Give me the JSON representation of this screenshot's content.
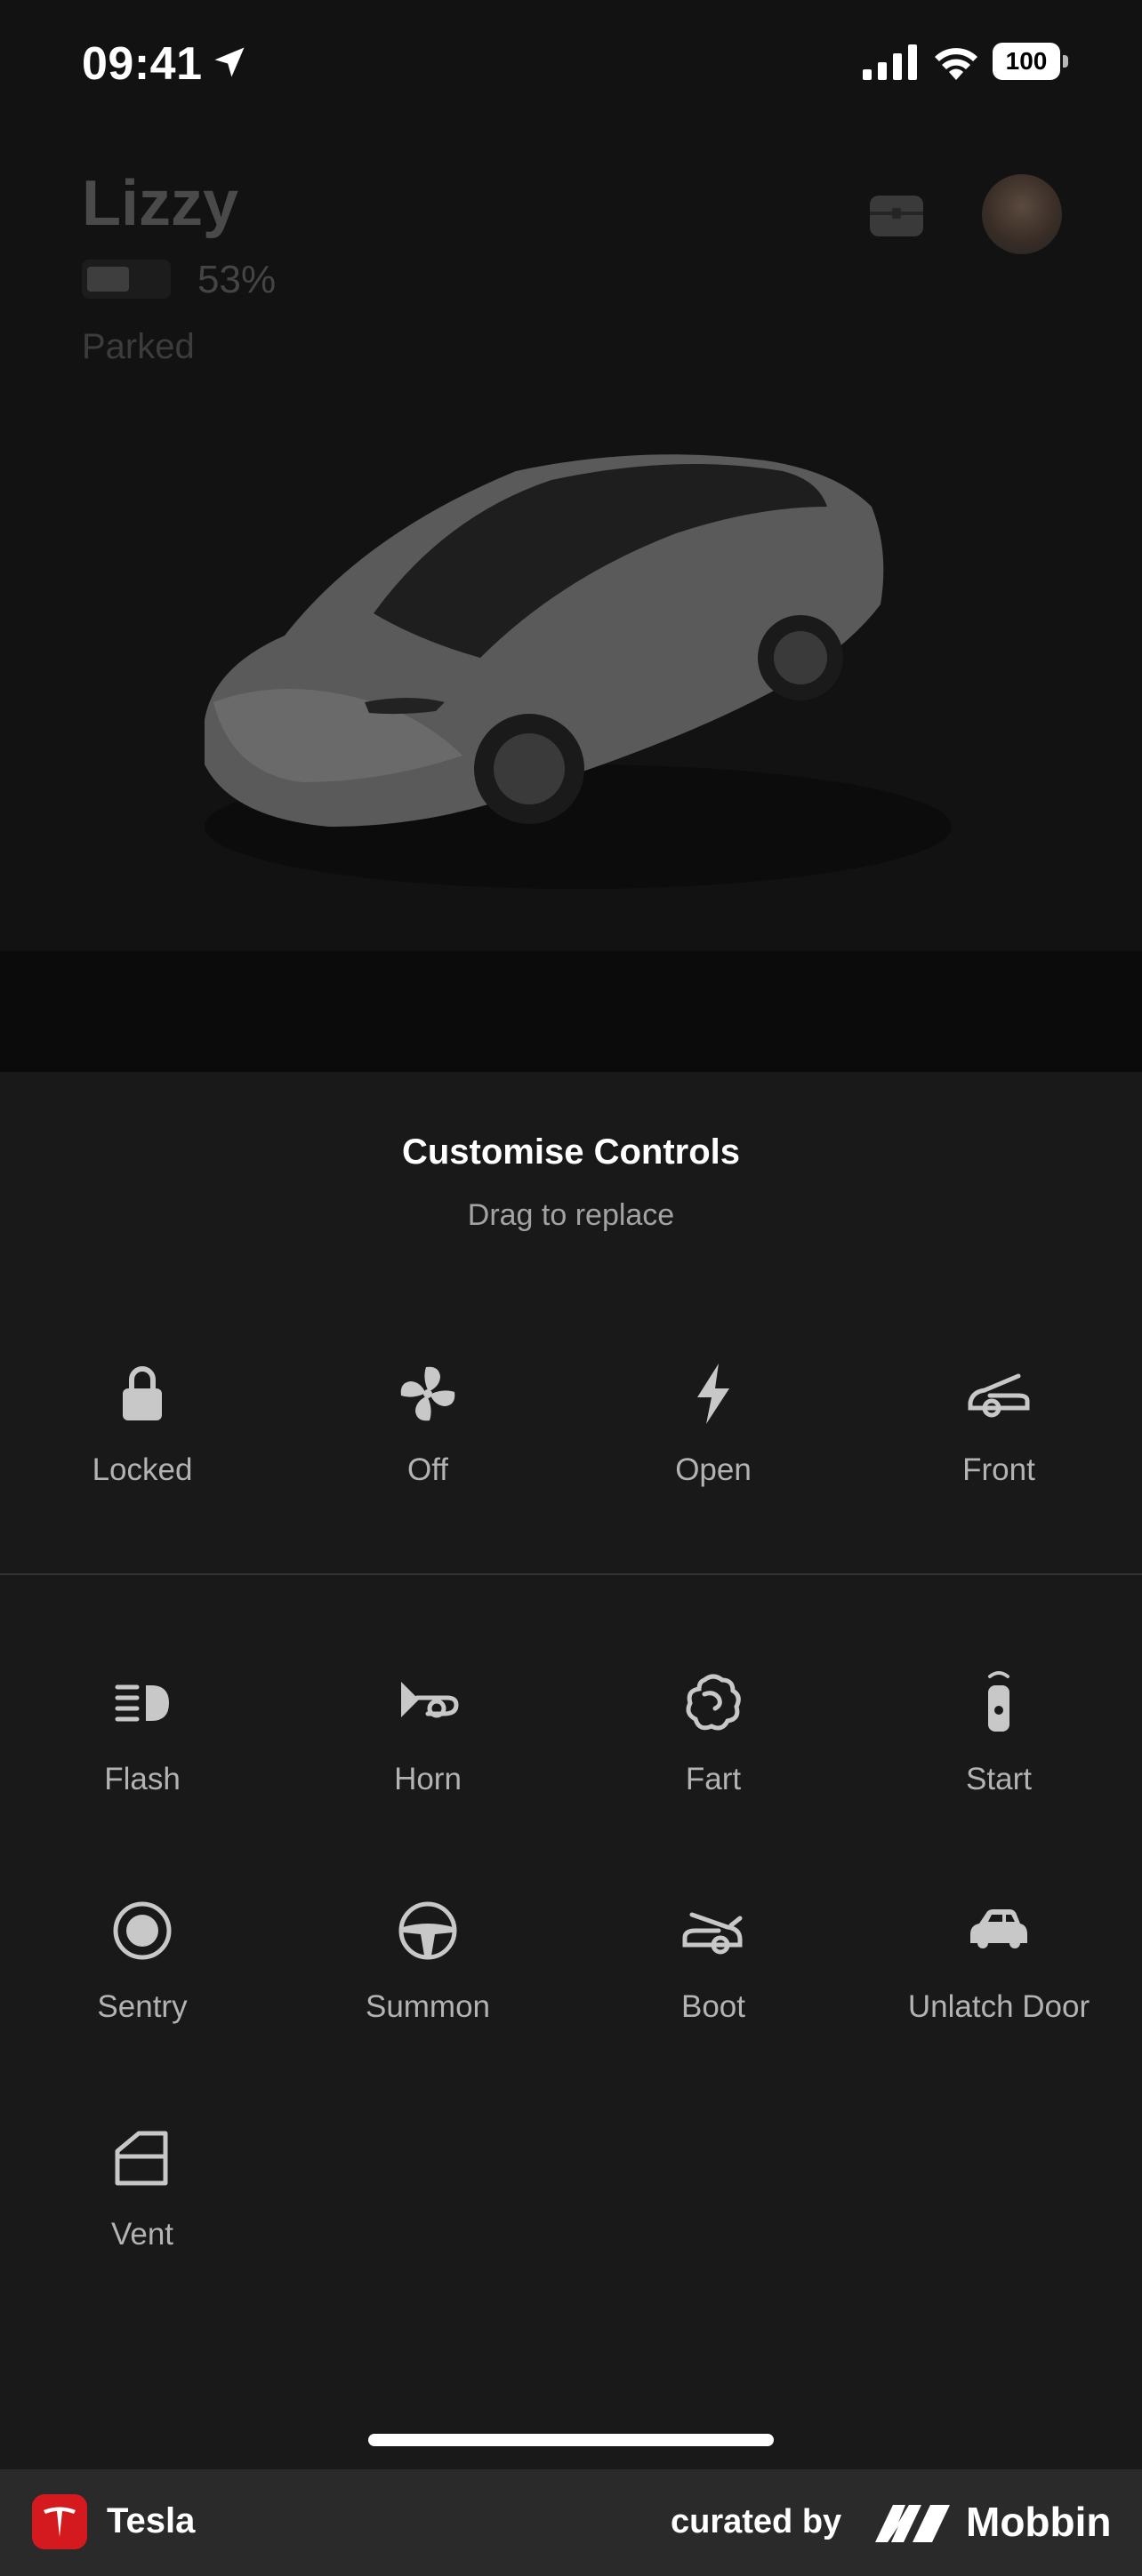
{
  "status_bar": {
    "time": "09:41",
    "battery": "100"
  },
  "vehicle": {
    "name": "Lizzy",
    "battery_percent": "53%",
    "battery_fraction": 0.53,
    "state": "Parked"
  },
  "sheet": {
    "title": "Customise Controls",
    "subtitle": "Drag to replace",
    "active_controls": [
      {
        "label": "Locked",
        "icon": "lock-icon"
      },
      {
        "label": "Off",
        "icon": "fan-icon"
      },
      {
        "label": "Open",
        "icon": "bolt-icon"
      },
      {
        "label": "Front",
        "icon": "frunk-icon"
      }
    ],
    "available_controls": [
      {
        "label": "Flash",
        "icon": "headlight-flash-icon"
      },
      {
        "label": "Horn",
        "icon": "horn-icon"
      },
      {
        "label": "Fart",
        "icon": "fart-icon"
      },
      {
        "label": "Start",
        "icon": "key-fob-icon"
      },
      {
        "label": "Sentry",
        "icon": "sentry-icon"
      },
      {
        "label": "Summon",
        "icon": "steering-wheel-icon"
      },
      {
        "label": "Boot",
        "icon": "boot-icon"
      },
      {
        "label": "Unlatch Door",
        "icon": "car-door-icon"
      },
      {
        "label": "Vent",
        "icon": "window-vent-icon"
      }
    ]
  },
  "footer": {
    "app_name": "Tesla",
    "curated_by": "curated by",
    "brand": "Mobbin"
  },
  "colors": {
    "sheet_bg": "#191919",
    "label": "#b3b3b3",
    "icon": "#c8c8c8",
    "tesla_red": "#d41a1f"
  }
}
